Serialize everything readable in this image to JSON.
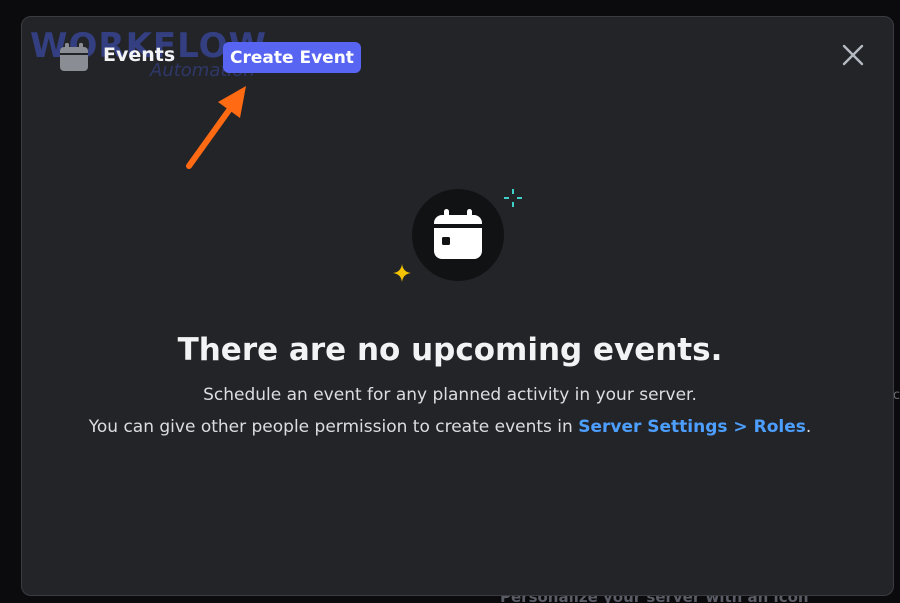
{
  "background": {
    "hint_text": "Personalize your server with an icon",
    "edge_text": "c"
  },
  "watermark": {
    "text": "WORKFLOW",
    "subtext": "Automation"
  },
  "modal": {
    "title": "Events",
    "create_button_label": "Create Event",
    "empty_title": "There are no upcoming events.",
    "empty_line1": "Schedule an event for any planned activity in your server.",
    "empty_line2_prefix": "You can give other people permission to create events in ",
    "empty_line2_link": "Server Settings > Roles",
    "empty_line2_suffix": "."
  },
  "icons": {
    "header": "calendar-icon",
    "close": "close-icon",
    "illustration": "calendar-icon",
    "annotation": "arrow-icon"
  },
  "colors": {
    "accent": "#5865f2",
    "link": "#4d9fff",
    "arrow": "#ff6a13",
    "sparkle_teal": "#3fd0c9",
    "sparkle_yellow": "#f5c400"
  }
}
